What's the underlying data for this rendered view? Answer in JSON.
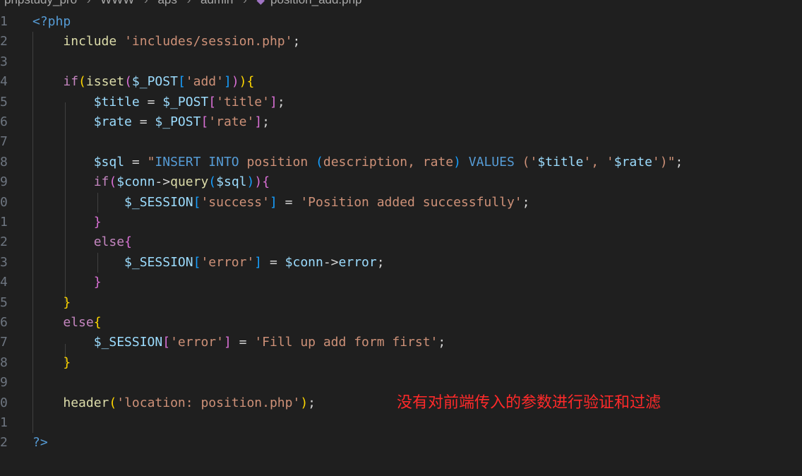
{
  "breadcrumb": {
    "items": [
      "phpstudy_pro",
      "WWW",
      "aps",
      "admin"
    ],
    "file": "position_add.php"
  },
  "editor": {
    "line_numbers": [
      "1",
      "2",
      "3",
      "4",
      "5",
      "6",
      "7",
      "8",
      "9",
      "0",
      "1",
      "2",
      "3",
      "4",
      "5",
      "6",
      "7",
      "8",
      "9",
      "0",
      "1",
      "2"
    ],
    "lines": [
      [
        [
          "t-tag",
          "<?php"
        ]
      ],
      [
        [
          "t-plain",
          "    "
        ],
        [
          "t-fn",
          "include"
        ],
        [
          "t-plain",
          " "
        ],
        [
          "t-str",
          "'includes/session.php'"
        ],
        [
          "t-plain",
          ";"
        ]
      ],
      [],
      [
        [
          "t-plain",
          "    "
        ],
        [
          "t-kw",
          "if"
        ],
        [
          "t-p1",
          "("
        ],
        [
          "t-fn",
          "isset"
        ],
        [
          "t-p2",
          "("
        ],
        [
          "t-var",
          "$_POST"
        ],
        [
          "t-p3",
          "["
        ],
        [
          "t-str",
          "'add'"
        ],
        [
          "t-p3",
          "]"
        ],
        [
          "t-p2",
          ")"
        ],
        [
          "t-p1",
          ")"
        ],
        [
          "t-p1",
          "{"
        ]
      ],
      [
        [
          "t-plain",
          "        "
        ],
        [
          "t-var",
          "$title"
        ],
        [
          "t-plain",
          " = "
        ],
        [
          "t-var",
          "$_POST"
        ],
        [
          "t-p2",
          "["
        ],
        [
          "t-str",
          "'title'"
        ],
        [
          "t-p2",
          "]"
        ],
        [
          "t-plain",
          ";"
        ]
      ],
      [
        [
          "t-plain",
          "        "
        ],
        [
          "t-var",
          "$rate"
        ],
        [
          "t-plain",
          " = "
        ],
        [
          "t-var",
          "$_POST"
        ],
        [
          "t-p2",
          "["
        ],
        [
          "t-str",
          "'rate'"
        ],
        [
          "t-p2",
          "]"
        ],
        [
          "t-plain",
          ";"
        ]
      ],
      [],
      [
        [
          "t-plain",
          "        "
        ],
        [
          "t-var",
          "$sql"
        ],
        [
          "t-plain",
          " = "
        ],
        [
          "t-str",
          "\""
        ],
        [
          "t-sqlkw",
          "INSERT INTO"
        ],
        [
          "t-str",
          " position "
        ],
        [
          "t-p3",
          "("
        ],
        [
          "t-str",
          "description, rate"
        ],
        [
          "t-p3",
          ")"
        ],
        [
          "t-str",
          " "
        ],
        [
          "t-sqlkw",
          "VALUES"
        ],
        [
          "t-str",
          " ("
        ],
        [
          "t-str",
          "'"
        ],
        [
          "t-var",
          "$title"
        ],
        [
          "t-str",
          "', '"
        ],
        [
          "t-var",
          "$rate"
        ],
        [
          "t-str",
          "')"
        ],
        [
          "t-str",
          "\""
        ],
        [
          "t-plain",
          ";"
        ]
      ],
      [
        [
          "t-plain",
          "        "
        ],
        [
          "t-kw",
          "if"
        ],
        [
          "t-p2",
          "("
        ],
        [
          "t-var",
          "$conn"
        ],
        [
          "t-plain",
          "->"
        ],
        [
          "t-fn",
          "query"
        ],
        [
          "t-p3",
          "("
        ],
        [
          "t-var",
          "$sql"
        ],
        [
          "t-p3",
          ")"
        ],
        [
          "t-p2",
          ")"
        ],
        [
          "t-p2",
          "{"
        ]
      ],
      [
        [
          "t-plain",
          "            "
        ],
        [
          "t-var",
          "$_SESSION"
        ],
        [
          "t-p3",
          "["
        ],
        [
          "t-str",
          "'success'"
        ],
        [
          "t-p3",
          "]"
        ],
        [
          "t-plain",
          " = "
        ],
        [
          "t-str",
          "'Position added successfully'"
        ],
        [
          "t-plain",
          ";"
        ]
      ],
      [
        [
          "t-plain",
          "        "
        ],
        [
          "t-p2",
          "}"
        ]
      ],
      [
        [
          "t-plain",
          "        "
        ],
        [
          "t-kw",
          "else"
        ],
        [
          "t-p2",
          "{"
        ]
      ],
      [
        [
          "t-plain",
          "            "
        ],
        [
          "t-var",
          "$_SESSION"
        ],
        [
          "t-p3",
          "["
        ],
        [
          "t-str",
          "'error'"
        ],
        [
          "t-p3",
          "]"
        ],
        [
          "t-plain",
          " = "
        ],
        [
          "t-var",
          "$conn"
        ],
        [
          "t-plain",
          "->"
        ],
        [
          "t-var",
          "error"
        ],
        [
          "t-plain",
          ";"
        ]
      ],
      [
        [
          "t-plain",
          "        "
        ],
        [
          "t-p2",
          "}"
        ]
      ],
      [
        [
          "t-plain",
          "    "
        ],
        [
          "t-p1",
          "}"
        ]
      ],
      [
        [
          "t-plain",
          "    "
        ],
        [
          "t-kw",
          "else"
        ],
        [
          "t-p1",
          "{"
        ]
      ],
      [
        [
          "t-plain",
          "        "
        ],
        [
          "t-var",
          "$_SESSION"
        ],
        [
          "t-p2",
          "["
        ],
        [
          "t-str",
          "'error'"
        ],
        [
          "t-p2",
          "]"
        ],
        [
          "t-plain",
          " = "
        ],
        [
          "t-str",
          "'Fill up add form first'"
        ],
        [
          "t-plain",
          ";"
        ]
      ],
      [
        [
          "t-plain",
          "    "
        ],
        [
          "t-p1",
          "}"
        ]
      ],
      [],
      [
        [
          "t-plain",
          "    "
        ],
        [
          "t-fn",
          "header"
        ],
        [
          "t-p1",
          "("
        ],
        [
          "t-str",
          "'location: position.php'"
        ],
        [
          "t-p1",
          ")"
        ],
        [
          "t-plain",
          ";"
        ]
      ],
      [],
      [
        [
          "t-tag",
          "?>"
        ]
      ]
    ]
  },
  "annotation": "没有对前端传入的参数进行验证和过滤"
}
